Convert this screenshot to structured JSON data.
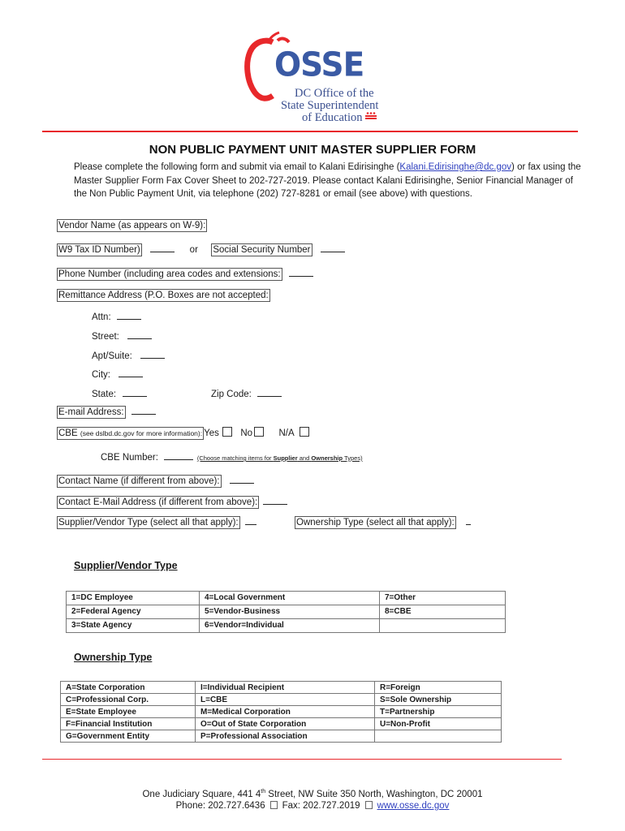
{
  "logo": {
    "acronym": "OSSE",
    "line1": "DC Office of the",
    "line2": "State Superintendent",
    "line3": "of Education",
    "brand_blue": "#3a5aa4",
    "brand_red": "#e8282b"
  },
  "title": "NON PUBLIC PAYMENT UNIT MASTER SUPPLIER FORM",
  "intro": {
    "part1": "Please complete the following form and submit via email to Kalani Edirisinghe (",
    "email": "Kalani.Edirisinghe@dc.gov",
    "part2": ") or fax using the Master Supplier Form Fax Cover Sheet to 202-727-2019.   Please contact Kalani Edirisinghe, Senior Financial Manager of the Non Public Payment Unit, via telephone (202) 727-8281 or email (see above) with questions."
  },
  "fields": {
    "vendor_name": "Vendor Name (as appears on W-9):",
    "w9_tax_id": "W9 Tax ID Number)",
    "or": "or",
    "ssn": "Social Security Number",
    "phone": "Phone Number (including area codes and extensions:",
    "remittance": "Remittance Address (P.O. Boxes are not accepted:",
    "attn": "Attn:",
    "street": "Street:",
    "apt_suite": "Apt/Suite:",
    "city": "City:",
    "state": "State:",
    "zip": "Zip Code:",
    "email": "E-mail Address:",
    "cbe_label": "CBE",
    "cbe_note": "(see dslbd.dc.gov for more information):",
    "cbe_yes": "Yes",
    "cbe_no": "No",
    "cbe_na": "N/A",
    "cbe_number": "CBE Number:",
    "cbe_hint_1": "(Choose matching items for ",
    "cbe_hint_supplier": "Supplier",
    "cbe_hint_and": " and ",
    "cbe_hint_ownership": "Ownership",
    "cbe_hint_2": " Types)",
    "contact_name": "Contact Name (if different from above):",
    "contact_email": "Contact E-Mail Address (if different from above):",
    "supplier_type": "Supplier/Vendor Type (select all that apply):",
    "ownership_type": "Ownership Type (select all that apply):"
  },
  "supplier_section": {
    "title": "Supplier/Vendor Type",
    "rows": [
      [
        "1=DC Employee",
        "4=Local Government",
        "7=Other"
      ],
      [
        "2=Federal Agency",
        "5=Vendor-Business",
        "8=CBE"
      ],
      [
        "3=State Agency",
        "6=Vendor=Individual",
        ""
      ]
    ]
  },
  "ownership_section": {
    "title": "Ownership Type",
    "rows": [
      [
        "A=State Corporation",
        "I=Individual Recipient",
        "R=Foreign"
      ],
      [
        "C=Professional Corp.",
        "L=CBE",
        "S=Sole Ownership"
      ],
      [
        "E=State Employee",
        "M=Medical Corporation",
        "T=Partnership"
      ],
      [
        "F=Financial Institution",
        "O=Out of  State Corporation",
        "U=Non-Profit"
      ],
      [
        "G=Government Entity",
        "P=Professional Association",
        ""
      ]
    ]
  },
  "footer": {
    "address_pre": "One Judiciary Square, 441 4",
    "address_sup": "th",
    "address_post": " Street, NW Suite 350 North, Washington, DC 20001",
    "phone": "Phone: 202.727.6436",
    "fax": "Fax: 202.727.2019",
    "website": "www.osse.dc.gov"
  }
}
